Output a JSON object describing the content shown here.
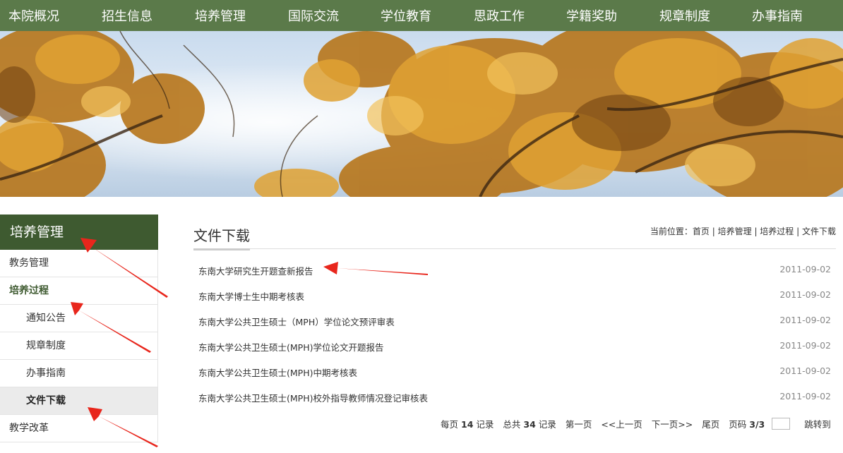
{
  "nav": {
    "items": [
      "本院概况",
      "招生信息",
      "培养管理",
      "国际交流",
      "学位教育",
      "思政工作",
      "学籍奖助",
      "规章制度",
      "办事指南"
    ]
  },
  "sidebar": {
    "title": "培养管理",
    "items": [
      {
        "label": "教务管理"
      },
      {
        "label": "培养过程"
      },
      {
        "label": "通知公告"
      },
      {
        "label": "规章制度"
      },
      {
        "label": "办事指南"
      },
      {
        "label": "文件下载"
      },
      {
        "label": "教学改革"
      }
    ]
  },
  "main": {
    "title": "文件下载",
    "breadcrumb": {
      "prefix": "当前位置：",
      "items": [
        "首页",
        "培养管理",
        "培养过程",
        "文件下载"
      ],
      "separator": " | "
    },
    "files": [
      {
        "name": "东南大学研究生开题查新报告",
        "date": "2011-09-02"
      },
      {
        "name": "东南大学博士生中期考核表",
        "date": "2011-09-02"
      },
      {
        "name": "东南大学公共卫生硕士（MPH）学位论文预评审表",
        "date": "2011-09-02"
      },
      {
        "name": "东南大学公共卫生硕士(MPH)学位论文开题报告",
        "date": "2011-09-02"
      },
      {
        "name": "东南大学公共卫生硕士(MPH)中期考核表",
        "date": "2011-09-02"
      },
      {
        "name": "东南大学公共卫生硕士(MPH)校外指导教师情况登记审核表",
        "date": "2011-09-02"
      }
    ],
    "pager": {
      "per_page_prefix": "每页",
      "per_page": "14",
      "per_page_suffix": "记录",
      "total_prefix": "总共",
      "total": "34",
      "total_suffix": "记录",
      "first": "第一页",
      "prev": "<<上一页",
      "next": "下一页>>",
      "last": "尾页",
      "page_prefix": "页码",
      "page": "3/3",
      "jump": "跳转到"
    }
  },
  "colors": {
    "nav_bg": "#5b7a4a",
    "sidebar_title_bg": "#3e5a30",
    "arrow": "#e8261c"
  }
}
